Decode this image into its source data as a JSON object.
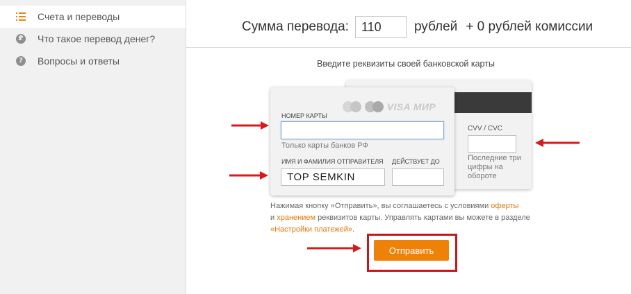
{
  "sidebar": {
    "items": [
      {
        "label": "Счета и переводы",
        "icon": "list-icon",
        "active": true
      },
      {
        "label": "Что такое перевод денег?",
        "icon": "ruble-icon",
        "active": false
      },
      {
        "label": "Вопросы и ответы",
        "icon": "question-icon",
        "active": false
      }
    ]
  },
  "header": {
    "amount_label": "Сумма перевода:",
    "amount_value": "110",
    "currency": "рублей",
    "fee": "+ 0 рублей комиссии"
  },
  "instructions": "Введите реквизиты своей банковской карты",
  "card_front": {
    "logos": [
      "mastercard-logo",
      "maestro-logo",
      "VISA",
      "МИР"
    ],
    "number_label": "НОМЕР КАРТЫ",
    "number_value": "",
    "number_hint": "Только карты банков РФ",
    "name_label": "ИМЯ И ФАМИЛИЯ ОТПРАВИТЕЛЯ",
    "name_value": "TOP SEMKIN",
    "expiry_label": "ДЕЙСТВУЕТ ДО",
    "expiry_value": ""
  },
  "card_back": {
    "cvv_label": "CVV / CVC",
    "cvv_value": "",
    "cvv_hint": "Последние три цифры на обороте"
  },
  "agreement": {
    "part1": "Нажимая кнопку «Отправить», вы соглашаетесь с условиями ",
    "link_offer": "оферты",
    "part2": "и ",
    "link_storage": "хранением",
    "part3": " реквизитов карты. Управлять картами вы можете в разделе",
    "link_settings": "«Настройки платежей»",
    "part4": "."
  },
  "submit_label": "Отправить",
  "colors": {
    "accent": "#ee8208",
    "annotation_red": "#c8161b",
    "sidebar_bg": "#f1f1f1"
  }
}
